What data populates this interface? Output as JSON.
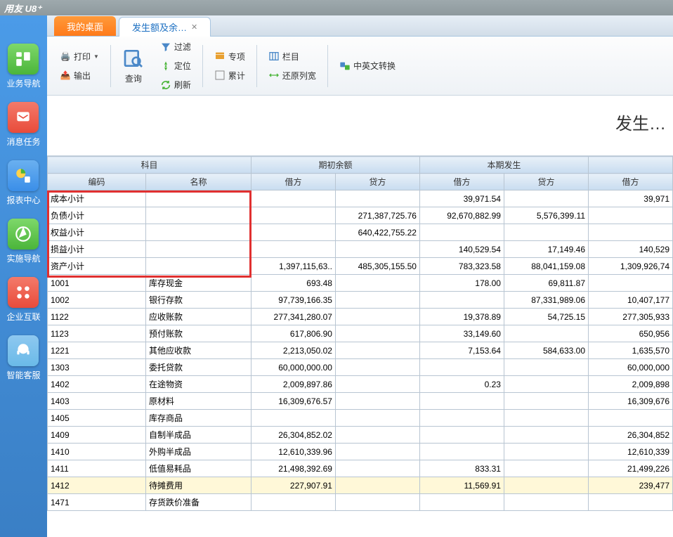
{
  "app_title": "用友 U8⁺",
  "tabs": {
    "desktop": "我的桌面",
    "current": "发生额及余…"
  },
  "ribbon": {
    "print": "打印",
    "output": "输出",
    "query": "查询",
    "filter": "过滤",
    "locate": "定位",
    "refresh": "刷新",
    "special": "专项",
    "accum": "累计",
    "columns": "栏目",
    "restore_width": "还原列宽",
    "cn_en": "中英文转换"
  },
  "report_title": "发生…",
  "columns": {
    "subject": "科目",
    "code": "编码",
    "name": "名称",
    "begin_balance": "期初余额",
    "current_period": "本期发生",
    "debit": "借方",
    "credit": "贷方"
  },
  "sidebar": [
    {
      "label": "业务导航",
      "color": "#4bb53a"
    },
    {
      "label": "消息任务",
      "color": "#e84b3a"
    },
    {
      "label": "报表中心",
      "color": "#3a8ee8"
    },
    {
      "label": "实施导航",
      "color": "#4bb53a"
    },
    {
      "label": "企业互联",
      "color": "#e84b3a"
    },
    {
      "label": "智能客服",
      "color": "#6abae8"
    }
  ],
  "rows": [
    {
      "code": "成本小计",
      "name": "",
      "d1": "",
      "c1": "",
      "d2": "39,971.54",
      "c2": "",
      "d3": "39,971"
    },
    {
      "code": "负债小计",
      "name": "",
      "d1": "",
      "c1": "271,387,725.76",
      "d2": "92,670,882.99",
      "c2": "5,576,399.11",
      "d3": ""
    },
    {
      "code": "权益小计",
      "name": "",
      "d1": "",
      "c1": "640,422,755.22",
      "d2": "",
      "c2": "",
      "d3": ""
    },
    {
      "code": "损益小计",
      "name": "",
      "d1": "",
      "c1": "",
      "d2": "140,529.54",
      "c2": "17,149.46",
      "d3": "140,529"
    },
    {
      "code": "资产小计",
      "name": "",
      "d1": "1,397,115,63..",
      "c1": "485,305,155.50",
      "d2": "783,323.58",
      "c2": "88,041,159.08",
      "d3": "1,309,926,74"
    },
    {
      "code": "1001",
      "name": "库存现金",
      "d1": "693.48",
      "c1": "",
      "d2": "178.00",
      "c2": "69,811.87",
      "d3": ""
    },
    {
      "code": "1002",
      "name": "银行存款",
      "d1": "97,739,166.35",
      "c1": "",
      "d2": "",
      "c2": "87,331,989.06",
      "d3": "10,407,177"
    },
    {
      "code": "1122",
      "name": "应收账款",
      "d1": "277,341,280.07",
      "c1": "",
      "d2": "19,378.89",
      "c2": "54,725.15",
      "d3": "277,305,933"
    },
    {
      "code": "1123",
      "name": "预付账款",
      "d1": "617,806.90",
      "c1": "",
      "d2": "33,149.60",
      "c2": "",
      "d3": "650,956"
    },
    {
      "code": "1221",
      "name": "其他应收款",
      "d1": "2,213,050.02",
      "c1": "",
      "d2": "7,153.64",
      "c2": "584,633.00",
      "d3": "1,635,570"
    },
    {
      "code": "1303",
      "name": "委托贷款",
      "d1": "60,000,000.00",
      "c1": "",
      "d2": "",
      "c2": "",
      "d3": "60,000,000"
    },
    {
      "code": "1402",
      "name": "在途物资",
      "d1": "2,009,897.86",
      "c1": "",
      "d2": "0.23",
      "c2": "",
      "d3": "2,009,898"
    },
    {
      "code": "1403",
      "name": "原材料",
      "d1": "16,309,676.57",
      "c1": "",
      "d2": "",
      "c2": "",
      "d3": "16,309,676"
    },
    {
      "code": "1405",
      "name": "库存商品",
      "d1": "",
      "c1": "",
      "d2": "",
      "c2": "",
      "d3": ""
    },
    {
      "code": "1409",
      "name": "自制半成品",
      "d1": "26,304,852.02",
      "c1": "",
      "d2": "",
      "c2": "",
      "d3": "26,304,852"
    },
    {
      "code": "1410",
      "name": "外购半成品",
      "d1": "12,610,339.96",
      "c1": "",
      "d2": "",
      "c2": "",
      "d3": "12,610,339"
    },
    {
      "code": "1411",
      "name": "低值易耗品",
      "d1": "21,498,392.69",
      "c1": "",
      "d2": "833.31",
      "c2": "",
      "d3": "21,499,226"
    },
    {
      "code": "1412",
      "name": "待摊费用",
      "d1": "227,907.91",
      "c1": "",
      "d2": "11,569.91",
      "c2": "",
      "d3": "239,477",
      "hl": true
    },
    {
      "code": "1471",
      "name": "存货跌价准备",
      "d1": "",
      "c1": "",
      "d2": "",
      "c2": "",
      "d3": ""
    }
  ]
}
